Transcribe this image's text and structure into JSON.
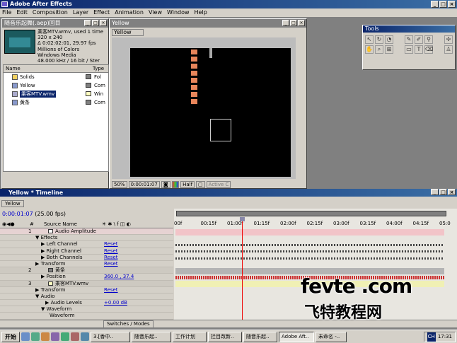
{
  "app": {
    "title": "Adobe After Effects"
  },
  "menu": [
    "File",
    "Edit",
    "Composition",
    "Layer",
    "Effect",
    "Animation",
    "View",
    "Window",
    "Help"
  ],
  "project": {
    "title": "随音乐起舞(.aep)回目",
    "info": [
      "乘客MTV.wmv, used 1 time",
      "320 x 240",
      "Δ 0:02:02:01, 29.97 fps",
      "Millions of Colors",
      "Windows Media",
      "48.000 kHz / 16 bit / Ster"
    ],
    "col_type": "Type",
    "items": [
      {
        "name": "Solids",
        "type": "Fol",
        "swatch": "#808080"
      },
      {
        "name": "Yellow",
        "type": "Com",
        "swatch": "#808080"
      },
      {
        "name": "乘客MTV.wmv",
        "type": "Win",
        "swatch": "#ffffc0"
      },
      {
        "name": "黄条",
        "type": "Com",
        "swatch": "#808080"
      }
    ]
  },
  "comp": {
    "title": "Yellow",
    "tab": "Yellow",
    "zoom": "50%",
    "time": "0:00:01:07",
    "res": "Half",
    "view": "Active C"
  },
  "tools": {
    "title": "Tools"
  },
  "timeline": {
    "title": "Yellow * Timeline",
    "tab": "Yellow",
    "time": "0:00:01:07",
    "fps": "(25.00 fps)",
    "col_source": "Source Name",
    "ruler": [
      "00f",
      "00:15f",
      "01:00f",
      "01:15f",
      "02:00f",
      "02:15f",
      "03:00f",
      "03:15f",
      "04:00f",
      "04:15f",
      "05:0"
    ],
    "rows": [
      {
        "label": "1",
        "name": "Audio Amplitude",
        "kind": "layer"
      },
      {
        "label": "Effects",
        "kind": "group"
      },
      {
        "label": "Left Channel",
        "value": "Reset",
        "kind": "prop"
      },
      {
        "label": "Right Channel",
        "value": "Reset",
        "kind": "prop"
      },
      {
        "label": "Both Channels",
        "value": "Reset",
        "kind": "prop"
      },
      {
        "label": "Transform",
        "value": "Reset",
        "kind": "group"
      },
      {
        "label": "2",
        "name": "黄条",
        "kind": "layer"
      },
      {
        "label": "Position",
        "value": "360.0 , 37.4",
        "kind": "prop"
      },
      {
        "label": "3",
        "name": "乘客MTV.wmv",
        "kind": "layer"
      },
      {
        "label": "Transform",
        "value": "Reset",
        "kind": "group"
      },
      {
        "label": "Audio",
        "kind": "group"
      },
      {
        "label": "Audio Levels",
        "value": "+0.00 dB",
        "kind": "prop"
      },
      {
        "label": "Waveform",
        "kind": "group"
      },
      {
        "label": "Waveform",
        "kind": "prop"
      }
    ],
    "switches_modes": "Switches / Modes"
  },
  "watermark": {
    "line1": "fevte .com",
    "line2": "飞特教程网"
  },
  "taskbar": {
    "start": "开始",
    "tasks": [
      "3.[香中..",
      "随音乐起..",
      "工作计划",
      "拦目改新..",
      "随音乐起..",
      "Adobe Aft..",
      "未命名 -.."
    ],
    "clock": "17:31",
    "lang": "CH"
  }
}
